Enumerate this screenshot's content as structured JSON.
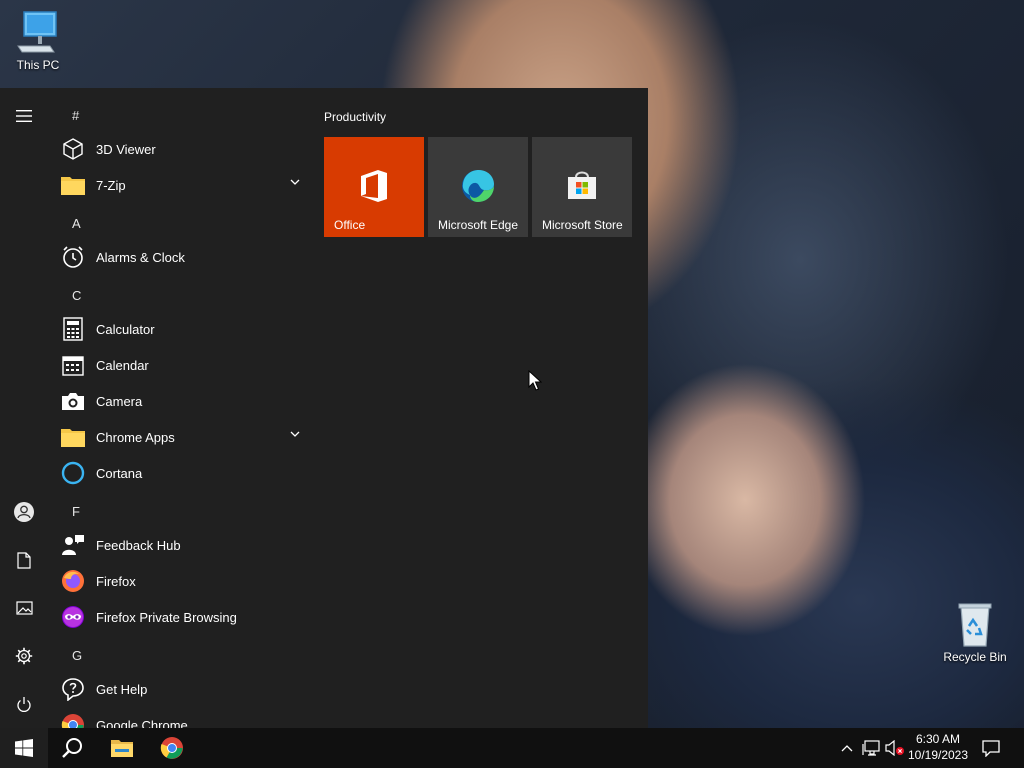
{
  "desktop": {
    "icons": [
      {
        "label": "This PC"
      },
      {
        "label": "Recycle Bin"
      }
    ]
  },
  "start_menu": {
    "headers": {
      "hash": "#",
      "a": "A",
      "c": "C",
      "f": "F",
      "g": "G"
    },
    "apps": {
      "viewer3d": "3D Viewer",
      "sevenzip": "7-Zip",
      "alarms": "Alarms & Clock",
      "calculator": "Calculator",
      "calendar": "Calendar",
      "camera": "Camera",
      "chrome_apps": "Chrome Apps",
      "cortana": "Cortana",
      "feedback": "Feedback Hub",
      "firefox": "Firefox",
      "firefox_private": "Firefox Private Browsing",
      "get_help": "Get Help",
      "google_chrome": "Google Chrome"
    },
    "tiles": {
      "group_title": "Productivity",
      "office": "Office",
      "edge": "Microsoft Edge",
      "store": "Microsoft Store"
    }
  },
  "taskbar": {
    "time": "6:30 AM",
    "date": "10/19/2023"
  },
  "colors": {
    "office_tile": "#d83b01",
    "tile_bg": "#3a3a3a",
    "menu_bg": "#202020",
    "taskbar_bg": "#101010"
  }
}
